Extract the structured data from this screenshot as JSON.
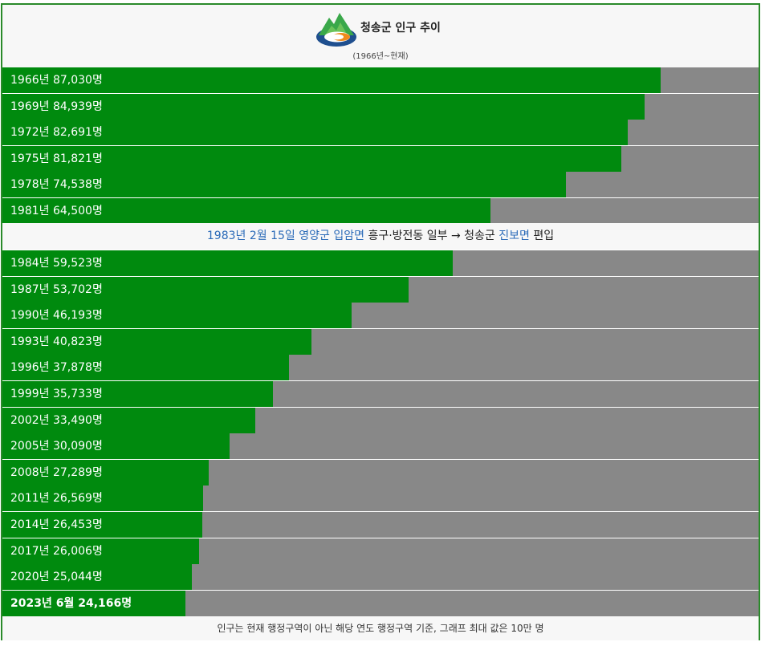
{
  "header": {
    "title": "청송군 인구 추이",
    "subtitle": "(1966년~현재)"
  },
  "event": {
    "date": "1983년 2월 15일",
    "from_county": "영양군",
    "from_town": "입암면",
    "villages": "흥구·방전동 일부",
    "arrow": "→",
    "to_county": "청송군",
    "to_town": "진보면",
    "action": "편입"
  },
  "footer": {
    "note": "인구는 현재 행정구역이 아닌 해당 연도 행정구역 기준, 그래프 최대 값은 10만 명"
  },
  "colors": {
    "bar": "#008a0e",
    "track": "#888888",
    "link": "#2a6ab8",
    "border": "#2a8a2a"
  },
  "chart_data": {
    "type": "bar",
    "orientation": "horizontal",
    "xlim": [
      0,
      100000
    ],
    "rows": [
      {
        "label": "1966년 87,030명",
        "value": 87030
      },
      {
        "label": "1969년 84,939명",
        "value": 84939
      },
      {
        "label": "1972년 82,691명",
        "value": 82691
      },
      {
        "label": "1975년 81,821명",
        "value": 81821
      },
      {
        "label": "1978년 74,538명",
        "value": 74538
      },
      {
        "label": "1981년 64,500명",
        "value": 64500
      },
      {
        "label": "1984년 59,523명",
        "value": 59523
      },
      {
        "label": "1987년 53,702명",
        "value": 53702
      },
      {
        "label": "1990년 46,193명",
        "value": 46193
      },
      {
        "label": "1993년 40,823명",
        "value": 40823
      },
      {
        "label": "1996년 37,878명",
        "value": 37878
      },
      {
        "label": "1999년 35,733명",
        "value": 35733
      },
      {
        "label": "2002년 33,490명",
        "value": 33490
      },
      {
        "label": "2005년 30,090명",
        "value": 30090
      },
      {
        "label": "2008년 27,289명",
        "value": 27289
      },
      {
        "label": "2011년 26,569명",
        "value": 26569
      },
      {
        "label": "2014년 26,453명",
        "value": 26453
      },
      {
        "label": "2017년 26,006명",
        "value": 26006
      },
      {
        "label": "2020년 25,044명",
        "value": 25044
      },
      {
        "label": "2023년 6월 24,166명",
        "value": 24166,
        "bold": true
      }
    ]
  }
}
